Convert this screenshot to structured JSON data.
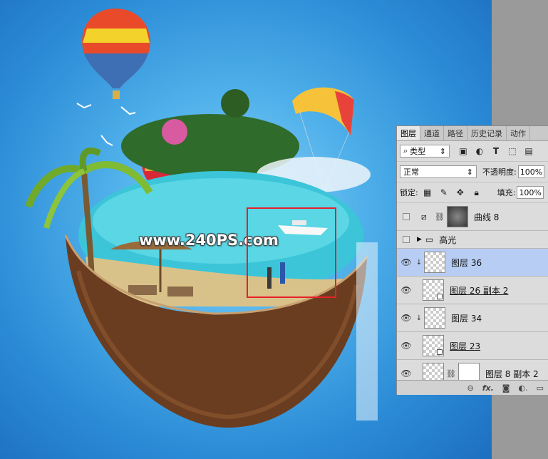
{
  "watermark": "www.240PS.com",
  "layers_panel": {
    "tabs": [
      "图层",
      "通道",
      "路径",
      "历史记录",
      "动作"
    ],
    "filter_kind": "类型",
    "blend_mode": "正常",
    "opacity_label": "不透明度:",
    "opacity_value": "100%",
    "lock_label": "锁定:",
    "fill_label": "填充:",
    "fill_value": "100%",
    "layers": [
      {
        "name": "曲线 8"
      },
      {
        "name": "高光"
      },
      {
        "name": "图层 36"
      },
      {
        "name": "图层 26 副本 2"
      },
      {
        "name": "图层 34"
      },
      {
        "name": "图层 23"
      },
      {
        "name": "图层 8 副本 2"
      }
    ],
    "footer_icons": [
      "link-icon",
      "fx-icon",
      "mask-icon",
      "adjustment-icon",
      "folder-icon"
    ]
  },
  "colors": {
    "selection": "#e8202a",
    "selected_row": "#b8cdf4",
    "sky": "#2b8bd6"
  }
}
